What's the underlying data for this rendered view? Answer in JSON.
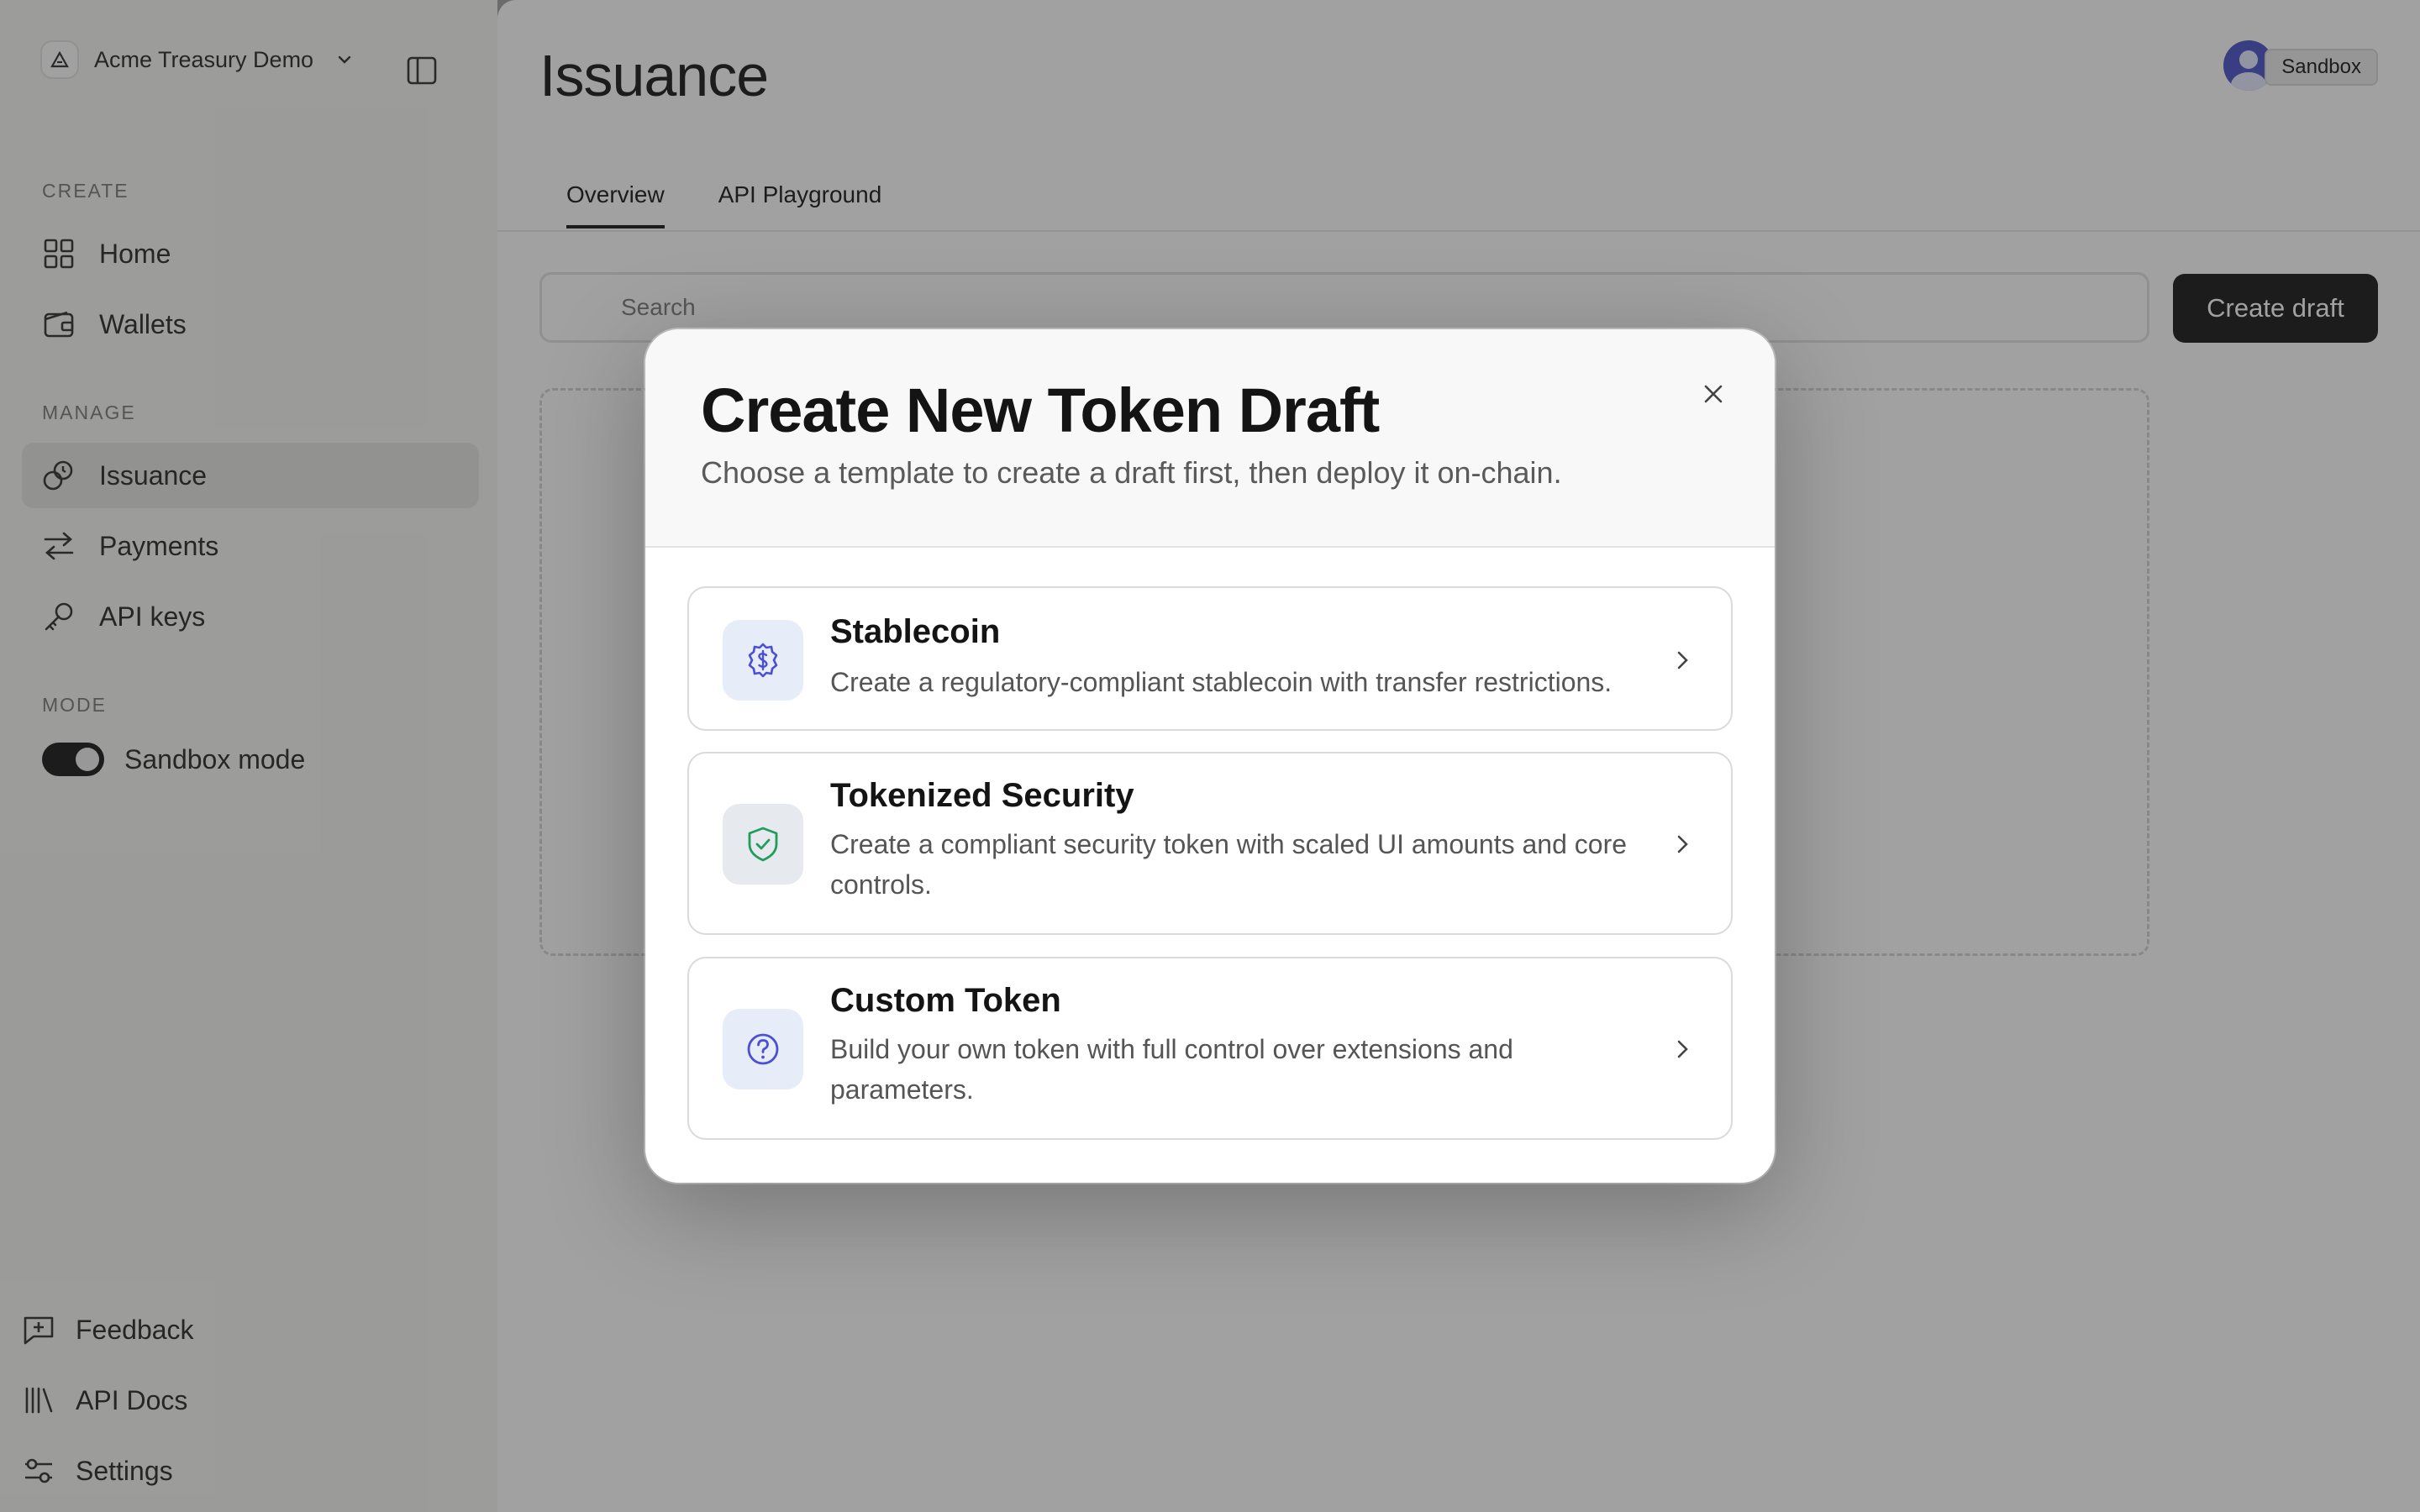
{
  "sidebar": {
    "workspace": "Acme Treasury Demo",
    "sections": {
      "create": "CREATE",
      "manage": "MANAGE",
      "mode": "MODE"
    },
    "items": {
      "home": "Home",
      "wallets": "Wallets",
      "issuance": "Issuance",
      "payments": "Payments",
      "api_keys": "API keys"
    },
    "sandbox_toggle": {
      "label": "Sandbox mode",
      "on": true
    },
    "footer": {
      "feedback": "Feedback",
      "api_docs": "API Docs",
      "settings": "Settings"
    }
  },
  "main": {
    "title": "Issuance",
    "badge": "Sandbox",
    "tabs": [
      "Overview",
      "API Playground"
    ],
    "active_tab": "Overview",
    "search": {
      "placeholder": "Search"
    },
    "create_button": "Create draft"
  },
  "modal": {
    "title": "Create New Token Draft",
    "subtitle": "Choose a template to create a draft first, then deploy it on-chain.",
    "options": [
      {
        "title": "Stablecoin",
        "description": "Create a regulatory-compliant stablecoin with transfer restrictions.",
        "icon": "dollar-badge-icon",
        "icon_color": "#4b4fd6",
        "icon_bg": "#e7edf8"
      },
      {
        "title": "Tokenized Security",
        "description": "Create a compliant security token with scaled UI amounts and core controls.",
        "icon": "shield-check-icon",
        "icon_color": "#1f9d5b",
        "icon_bg": "#e6eaee"
      },
      {
        "title": "Custom Token",
        "description": "Build your own token with full control over extensions and parameters.",
        "icon": "question-circle-icon",
        "icon_color": "#4b4fd6",
        "icon_bg": "#e7edf8"
      }
    ]
  },
  "colors": {
    "primary_button": "#1b1b1b",
    "overlay": "rgba(30,30,30,0.42)",
    "avatar": "#4b55c9"
  }
}
